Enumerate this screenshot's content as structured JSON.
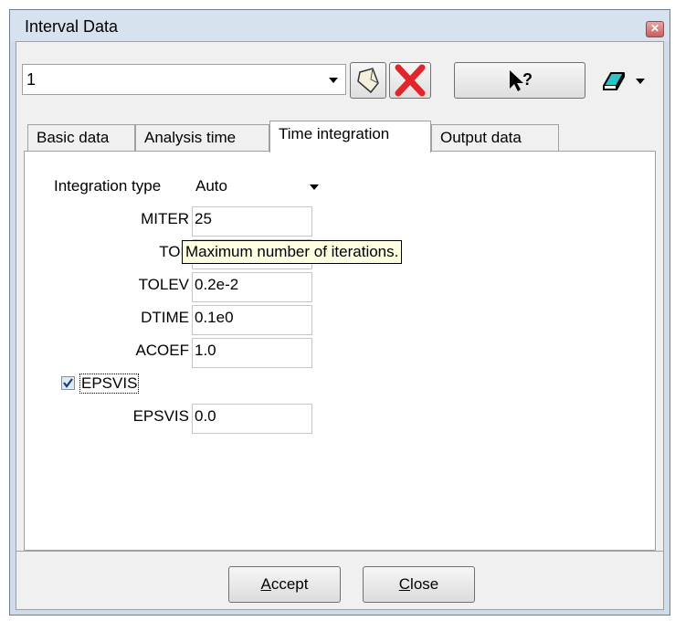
{
  "window": {
    "title": "Interval Data"
  },
  "toolbar": {
    "interval_value": "1",
    "icons": [
      "new-interval-icon",
      "delete-icon",
      "context-help-icon",
      "eraser-icon",
      "chevron-down-icon"
    ],
    "help_label": "?"
  },
  "tabs": [
    {
      "label": "Basic data",
      "active": false
    },
    {
      "label": "Analysis time",
      "active": false
    },
    {
      "label": "Time integration",
      "active": true
    },
    {
      "label": "Output data",
      "active": false
    }
  ],
  "form": {
    "integration_type_label": "Integration type",
    "integration_type_value": "Auto",
    "fields": [
      {
        "label": "MITER",
        "value": "25"
      },
      {
        "label": "TOL",
        "value": ""
      },
      {
        "label": "TOLEV",
        "value": "0.2e-2"
      },
      {
        "label": "DTIME",
        "value": "0.1e0"
      },
      {
        "label": "ACOEF",
        "value": "1.0"
      }
    ],
    "epsvis_checkbox_label": "EPSVIS",
    "epsvis_checked": true,
    "epsvis_field_label": "EPSVIS",
    "epsvis_field_value": "0.0"
  },
  "tooltip": {
    "text": "Maximum number of iterations."
  },
  "buttons": {
    "accept_mnemonic": "A",
    "accept_rest": "ccept",
    "close_mnemonic": "C",
    "close_rest": "lose"
  },
  "colors": {
    "delete_red": "#e0262b",
    "tooltip_bg": "#ffffe1",
    "eraser_teal": "#2cc4c8"
  }
}
